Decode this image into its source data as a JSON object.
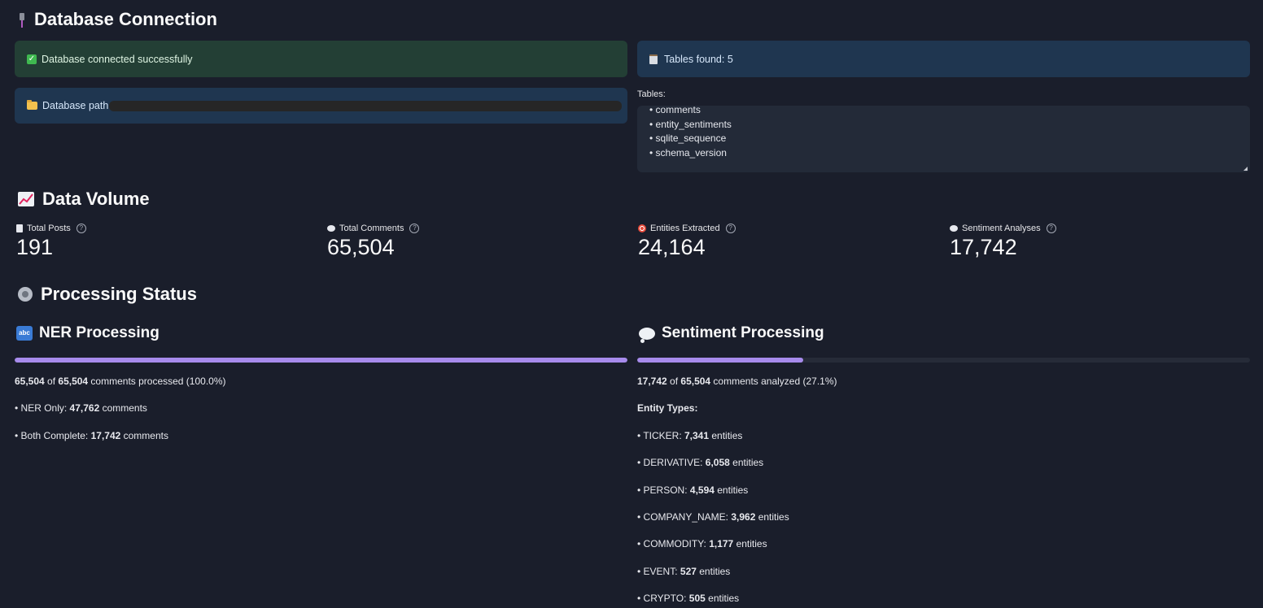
{
  "connection": {
    "title": "Database Connection",
    "success_text": "Database connected successfully",
    "tables_found_text": "Tables found: 5",
    "db_path_label": "Database path",
    "tables_label": "Tables:",
    "tables_list": [
      "• comments",
      "• entity_sentiments",
      "• sqlite_sequence",
      "• schema_version"
    ]
  },
  "volume": {
    "title": "Data Volume",
    "metrics": [
      {
        "label": "Total Posts",
        "value": "191"
      },
      {
        "label": "Total Comments",
        "value": "65,504"
      },
      {
        "label": "Entities Extracted",
        "value": "24,164"
      },
      {
        "label": "Sentiment Analyses",
        "value": "17,742"
      }
    ]
  },
  "processing": {
    "title": "Processing Status",
    "ner": {
      "title": "NER Processing",
      "progress": 1.0,
      "processed_count": "65,504",
      "of_text": " of ",
      "total": "65,504",
      "summary_suffix": " comments processed (100.0%)",
      "lines": [
        {
          "label": "• NER Only: ",
          "value": "47,762",
          "suffix": " comments"
        },
        {
          "label": "• Both Complete: ",
          "value": "17,742",
          "suffix": " comments"
        }
      ]
    },
    "sentiment": {
      "title": "Sentiment Processing",
      "progress": 0.271,
      "processed_count": "17,742",
      "of_text": " of ",
      "total": "65,504",
      "summary_suffix": " comments analyzed (27.1%)",
      "entity_types_label": "Entity Types:",
      "entity_types": [
        {
          "label": "• TICKER: ",
          "value": "7,341",
          "suffix": " entities"
        },
        {
          "label": "• DERIVATIVE: ",
          "value": "6,058",
          "suffix": " entities"
        },
        {
          "label": "• PERSON: ",
          "value": "4,594",
          "suffix": " entities"
        },
        {
          "label": "• COMPANY_NAME: ",
          "value": "3,962",
          "suffix": " entities"
        },
        {
          "label": "• COMMODITY: ",
          "value": "1,177",
          "suffix": " entities"
        },
        {
          "label": "• EVENT: ",
          "value": "527",
          "suffix": " entities"
        },
        {
          "label": "• CRYPTO: ",
          "value": "505",
          "suffix": " entities"
        }
      ]
    }
  },
  "icons": {
    "connection": "plug-icon",
    "volume": "chart-increasing-icon",
    "processing": "gear-icon",
    "ner": "abc-icon",
    "sentiment": "thought-bubble-icon"
  },
  "colors": {
    "background": "#1a1e2b",
    "success_bg": "#233f35",
    "info_bg": "#1f3650",
    "progress_fill": "#a78bec",
    "progress_track": "#262b38"
  }
}
